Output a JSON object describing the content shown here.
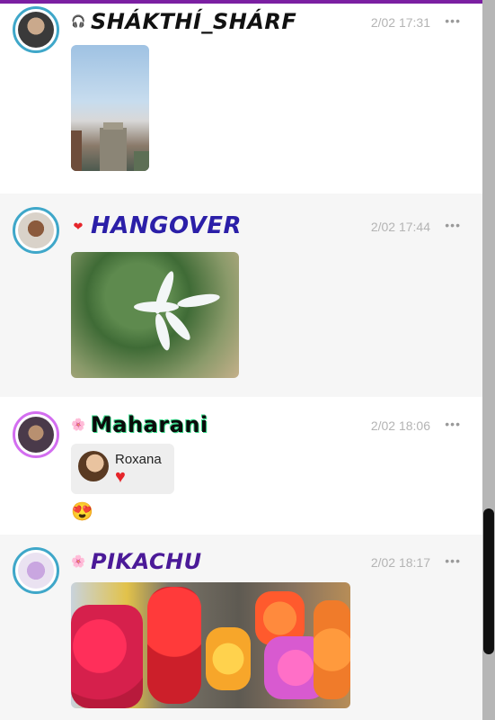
{
  "posts": [
    {
      "username": "SHÁKTHÍ_SHÁRF",
      "time": "2/02 17:31",
      "badge": "🎧",
      "more": "•••"
    },
    {
      "username": "HANGOVER",
      "time": "2/02 17:44",
      "badge": "❤",
      "more": "•••"
    },
    {
      "username": "Maharani",
      "time": "2/02 18:06",
      "badge": "🌸",
      "more": "•••",
      "reply": {
        "name": "Roxana",
        "reaction": "♥"
      },
      "message": "😍"
    },
    {
      "username": "PIKACHU",
      "time": "2/02 18:17",
      "badge": "🌸",
      "more": "•••"
    }
  ],
  "colors": {
    "accent": "#7b1fa2",
    "timestamp": "#b4b4b4",
    "heart": "#e5252a"
  }
}
